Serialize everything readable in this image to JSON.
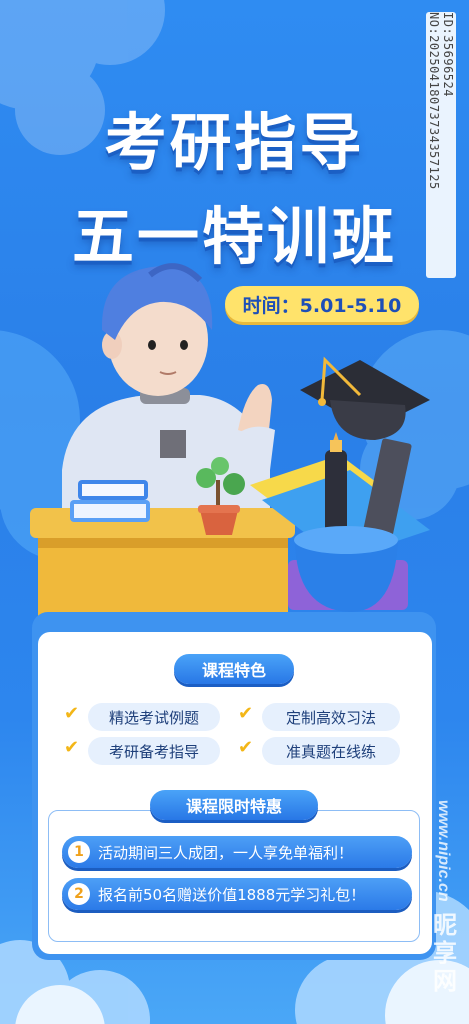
{
  "header": {
    "title_line1": "考研指导",
    "title_line2": "五一特训班",
    "time_label": "时间：5.01-5.10"
  },
  "watermark": {
    "text": "ID:35696524 NO:20250418073734357125"
  },
  "features": {
    "heading": "课程特色",
    "items": [
      {
        "label": "精选考试例题",
        "icon": "check-icon"
      },
      {
        "label": "定制高效习法",
        "icon": "check-icon"
      },
      {
        "label": "考研备考指导",
        "icon": "check-icon"
      },
      {
        "label": "准真题在线练",
        "icon": "check-icon"
      }
    ]
  },
  "offers": {
    "heading": "课程限时特惠",
    "items": [
      {
        "num": "1",
        "text": "活动期间三人成团，一人享免单福利！"
      },
      {
        "num": "2",
        "text": "报名前50名赠送价值1888元学习礼包！"
      }
    ]
  },
  "site_logo": {
    "url": "www.nipic.cn",
    "name": "昵享网"
  },
  "colors": {
    "background": "#2f8cf2",
    "accent_yellow": "#ffe36b",
    "card": "#ffffff",
    "title_text": "#ffffff"
  }
}
